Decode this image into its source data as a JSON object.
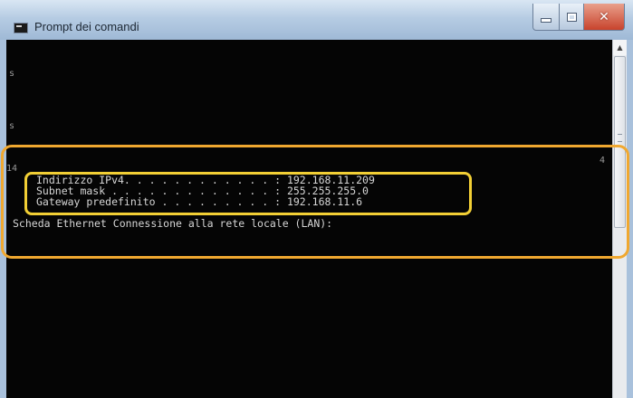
{
  "window": {
    "title": "Prompt dei comandi",
    "minimize_label": "–",
    "close_label": "✕",
    "icon": "console-icon"
  },
  "console": {
    "fragments": {
      "left_a": "s",
      "left_b": "s",
      "left_c": "14",
      "right_a": "4"
    },
    "ip_lines": [
      {
        "label": "Indirizzo IPv4. . . . . . . . . . . . : ",
        "value": "192.168.11.209"
      },
      {
        "label": "Subnet mask . . . . . . . . . . . . . : ",
        "value": "255.255.255.0"
      },
      {
        "label": "Gateway predefinito . . . . . . . . . : ",
        "value": "192.168.11.6"
      }
    ],
    "adapter_line": "Scheda Ethernet Connessione alla rete locale (LAN):"
  },
  "colors": {
    "console_bg": "#050505",
    "console_text": "#d6d6d6",
    "outer_highlight": "#f0a830",
    "inner_highlight": "#f2cf35",
    "close_button": "#c8432c"
  }
}
